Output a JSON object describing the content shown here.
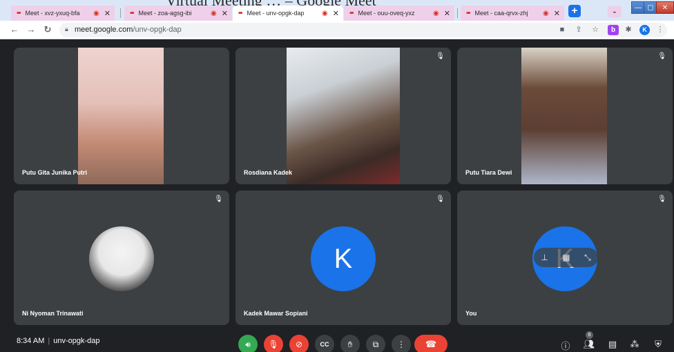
{
  "window_title": "Virtual Meeting … – Google Meet",
  "tabs": [
    {
      "title": "Meet - xvz-yxuq-bfa"
    },
    {
      "title": "Meet - zoa-agsg-ibi"
    },
    {
      "title": "Meet - unv-opgk-dap"
    },
    {
      "title": "Meet - ouu-oveq-yxz"
    },
    {
      "title": "Meet - caa-qrvx-zhj"
    }
  ],
  "address": {
    "domain": "meet.google.com",
    "path": "/unv-opgk-dap"
  },
  "toolbar": {
    "ext_b_label": "b",
    "profile_initial": "K"
  },
  "participants": [
    {
      "name": "Putu Gita Junika Putri"
    },
    {
      "name": "Rosdiana Kadek"
    },
    {
      "name": "Putu Tiara Dewi"
    },
    {
      "name": "Ni Nyoman Trinawati"
    },
    {
      "name": "Kadek Mawar Sopiani",
      "initial": "K"
    },
    {
      "name": "You",
      "initial": "K"
    }
  ],
  "bottom": {
    "time": "8:34 AM",
    "separator": "|",
    "meeting_code": "unv-opgk-dap",
    "participant_count": "6"
  },
  "colors": {
    "accent": "#1a73e8",
    "danger": "#ea4335",
    "success": "#34a853",
    "tile_bg": "#3c4043",
    "page_bg": "#202124"
  }
}
